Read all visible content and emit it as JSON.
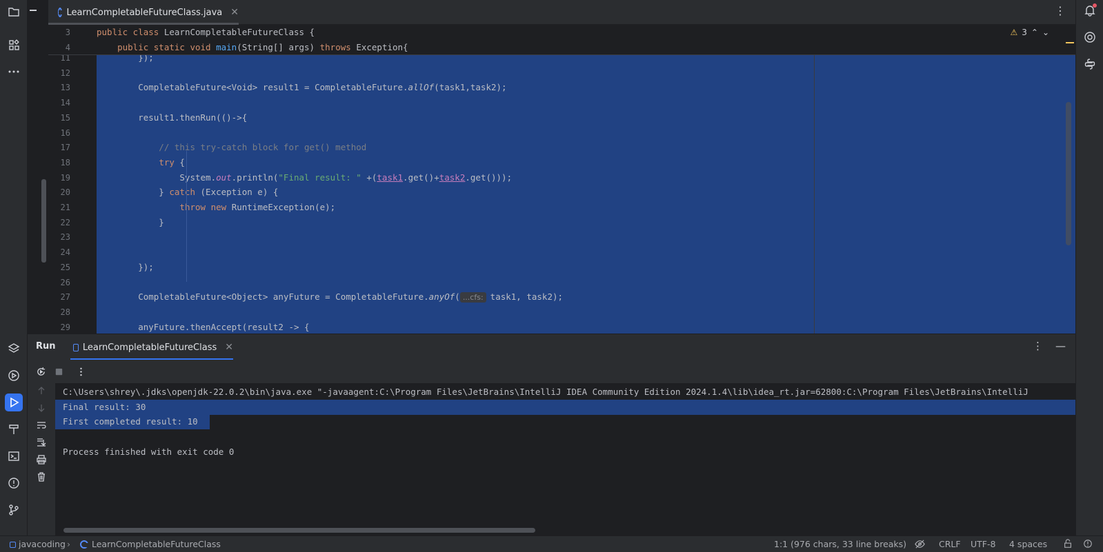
{
  "editor_tab": {
    "label": "LearnCompletableFutureClass.java"
  },
  "editor": {
    "warning_count": "3",
    "sticky_lines": [
      {
        "num": "3",
        "segments": [
          {
            "t": "public class ",
            "c": "kw"
          },
          {
            "t": "LearnCompletableFutureClass {",
            "c": ""
          }
        ]
      },
      {
        "num": "4",
        "segments": [
          {
            "t": "    public static void ",
            "c": "kw"
          },
          {
            "t": "main",
            "c": "fn"
          },
          {
            "t": "(String[] args) ",
            "c": ""
          },
          {
            "t": "throws ",
            "c": "kw"
          },
          {
            "t": "Exception{",
            "c": ""
          }
        ]
      }
    ],
    "lines": [
      {
        "num": "11",
        "segments": [
          {
            "t": "        });",
            "c": ""
          }
        ]
      },
      {
        "num": "12",
        "segments": []
      },
      {
        "num": "13",
        "segments": [
          {
            "t": "        CompletableFuture<Void> result1 = CompletableFuture.",
            "c": ""
          },
          {
            "t": "allOf",
            "c": "static-it"
          },
          {
            "t": "(task1,task2);",
            "c": ""
          }
        ]
      },
      {
        "num": "14",
        "segments": []
      },
      {
        "num": "15",
        "segments": [
          {
            "t": "        result1.thenRun(()->{",
            "c": ""
          }
        ]
      },
      {
        "num": "16",
        "segments": []
      },
      {
        "num": "17",
        "segments": [
          {
            "t": "            // this try-catch block for get() method",
            "c": "cm"
          }
        ]
      },
      {
        "num": "18",
        "segments": [
          {
            "t": "            ",
            "c": ""
          },
          {
            "t": "try ",
            "c": "kw"
          },
          {
            "t": "{",
            "c": ""
          }
        ]
      },
      {
        "num": "19",
        "segments": [
          {
            "t": "                System.",
            "c": ""
          },
          {
            "t": "out",
            "c": "it"
          },
          {
            "t": ".println(",
            "c": ""
          },
          {
            "t": "\"Final result: \"",
            "c": "str"
          },
          {
            "t": " +(",
            "c": ""
          },
          {
            "t": "task1",
            "c": "ul"
          },
          {
            "t": ".get()+",
            "c": ""
          },
          {
            "t": "task2",
            "c": "ul"
          },
          {
            "t": ".get()));",
            "c": ""
          }
        ]
      },
      {
        "num": "20",
        "segments": [
          {
            "t": "            } ",
            "c": ""
          },
          {
            "t": "catch ",
            "c": "kw"
          },
          {
            "t": "(Exception e) {",
            "c": ""
          }
        ]
      },
      {
        "num": "21",
        "segments": [
          {
            "t": "                ",
            "c": ""
          },
          {
            "t": "throw new ",
            "c": "kw"
          },
          {
            "t": "RuntimeException(e);",
            "c": ""
          }
        ]
      },
      {
        "num": "22",
        "segments": [
          {
            "t": "            }",
            "c": ""
          }
        ]
      },
      {
        "num": "23",
        "segments": []
      },
      {
        "num": "24",
        "segments": []
      },
      {
        "num": "25",
        "segments": [
          {
            "t": "        });",
            "c": ""
          }
        ]
      },
      {
        "num": "26",
        "segments": []
      },
      {
        "num": "27",
        "segments": [
          {
            "t": "        CompletableFuture<Object> anyFuture = CompletableFuture.",
            "c": ""
          },
          {
            "t": "anyOf",
            "c": "static-it"
          },
          {
            "t": "(",
            "c": ""
          },
          {
            "t": "...cfs:",
            "c": "hint"
          },
          {
            "t": "task1, task2);",
            "c": ""
          }
        ]
      },
      {
        "num": "28",
        "segments": []
      },
      {
        "num": "29",
        "segments": [
          {
            "t": "        anyFuture.thenAccept(result2 -> {",
            "c": ""
          }
        ]
      }
    ]
  },
  "run_panel": {
    "title": "Run",
    "tab_label": "LearnCompletableFutureClass",
    "console_lines": [
      {
        "text": "C:\\Users\\shrey\\.jdks\\openjdk-22.0.2\\bin\\java.exe \"-javaagent:C:\\Program Files\\JetBrains\\IntelliJ IDEA Community Edition 2024.1.4\\lib\\idea_rt.jar=62800:C:\\Program Files\\JetBrains\\IntelliJ",
        "selected": "none"
      },
      {
        "text": "Final result: 30",
        "selected": "full"
      },
      {
        "text": "First completed result: 10",
        "selected": "partial"
      },
      {
        "text": "",
        "selected": "none"
      },
      {
        "text": "Process finished with exit code 0",
        "selected": "none"
      }
    ]
  },
  "status_bar": {
    "project": "javacoding",
    "file": "LearnCompletableFutureClass",
    "position": "1:1 (976 chars, 33 line breaks)",
    "line_separator": "CRLF",
    "encoding": "UTF-8",
    "indent": "4 spaces"
  },
  "icons": {
    "left": [
      "folder-icon",
      "structure-icon",
      "more-icon",
      "layers-icon",
      "services-icon",
      "run-icon",
      "build-icon",
      "terminal-icon",
      "problems-icon",
      "git-icon"
    ],
    "right": [
      "notifications-icon",
      "ai-assistant-icon",
      "python-icon"
    ]
  },
  "colors": {
    "selection": "#214283",
    "accent": "#3574f0",
    "background": "#1e1f22",
    "panel": "#2b2d30"
  }
}
